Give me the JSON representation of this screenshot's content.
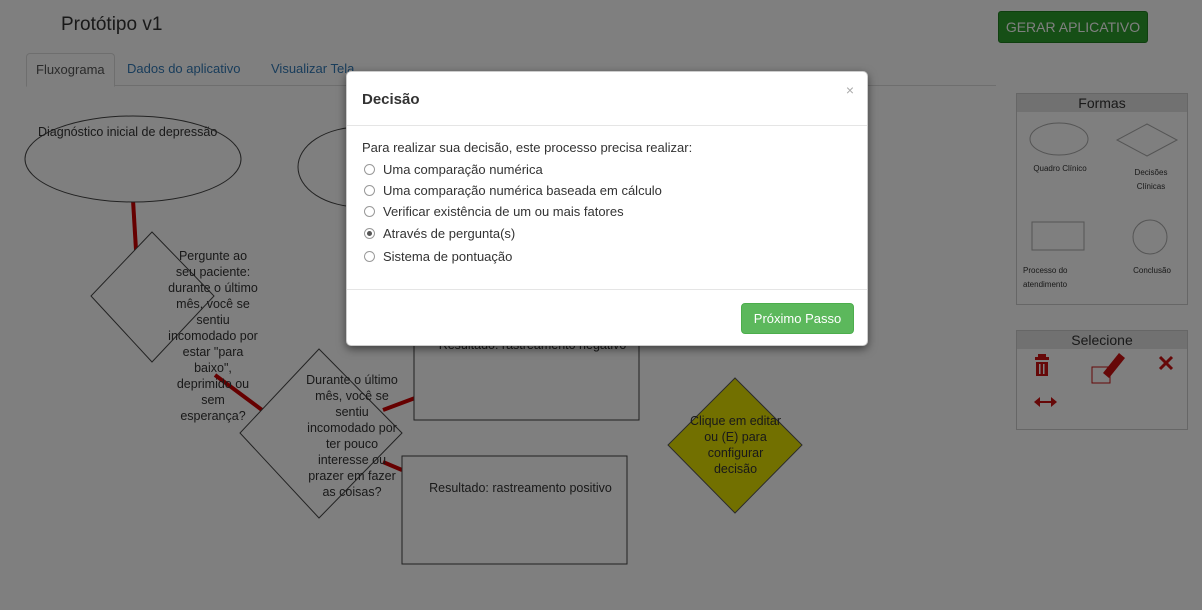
{
  "app": {
    "title": "Protótipo v1",
    "generate_button": "GERAR APLICATIVO"
  },
  "tabs": [
    {
      "label": "Fluxograma",
      "active": true
    },
    {
      "label": "Dados do aplicativo",
      "active": false
    },
    {
      "label": "Visualizar Tela",
      "active": false
    }
  ],
  "flowchart": {
    "start_node": "Diagnóstico inicial de depressão",
    "decision_1": "Pergunte ao seu paciente: durante o último mês, você se sentiu incomodado por estar \"para baixo\", deprimido ou sem esperança?",
    "decision_2": "Durante o último mês, você se sentiu incomodado por ter pouco interesse ou prazer em fazer as coisas?",
    "result_negative": "Resultado: rastreamento negativo",
    "result_positive": "Resultado: rastreamento positivo",
    "new_decision": "Clique em editar ou (E) para configurar decisão"
  },
  "shapes_panel": {
    "title": "Formas",
    "shapes": [
      {
        "label": "Quadro Clínico",
        "icon": "ellipse-shape-icon"
      },
      {
        "label": "Decisões Clínicas",
        "icon": "diamond-shape-icon"
      },
      {
        "label": "Processo do atendimento",
        "icon": "rectangle-shape-icon"
      },
      {
        "label": "Conclusão",
        "icon": "circle-shape-icon"
      }
    ]
  },
  "select_panel": {
    "title": "Selecione",
    "tools": [
      {
        "name": "delete",
        "icon": "trash-icon"
      },
      {
        "name": "edit",
        "icon": "pencil-icon"
      },
      {
        "name": "expand",
        "icon": "expand-icon"
      },
      {
        "name": "connect",
        "icon": "horizontal-arrows-icon"
      }
    ]
  },
  "modal": {
    "title": "Decisão",
    "close": "×",
    "question": "Para realizar sua decisão, este processo precisa realizar:",
    "options": [
      {
        "label": "Uma comparação numérica",
        "checked": false
      },
      {
        "label": "Uma comparação numérica baseada em cálculo",
        "checked": false
      },
      {
        "label": "Verificar existência de um ou mais fatores",
        "checked": false
      },
      {
        "label": "Através de pergunta(s)",
        "checked": true
      },
      {
        "label": "Sistema de pontuação",
        "checked": false
      }
    ],
    "next_button": "Próximo Passo"
  },
  "colors": {
    "connector": "#cc0000",
    "decision_fill": "#e5e000",
    "primary_green": "#5cb85c",
    "tool_red": "#cc1111"
  }
}
